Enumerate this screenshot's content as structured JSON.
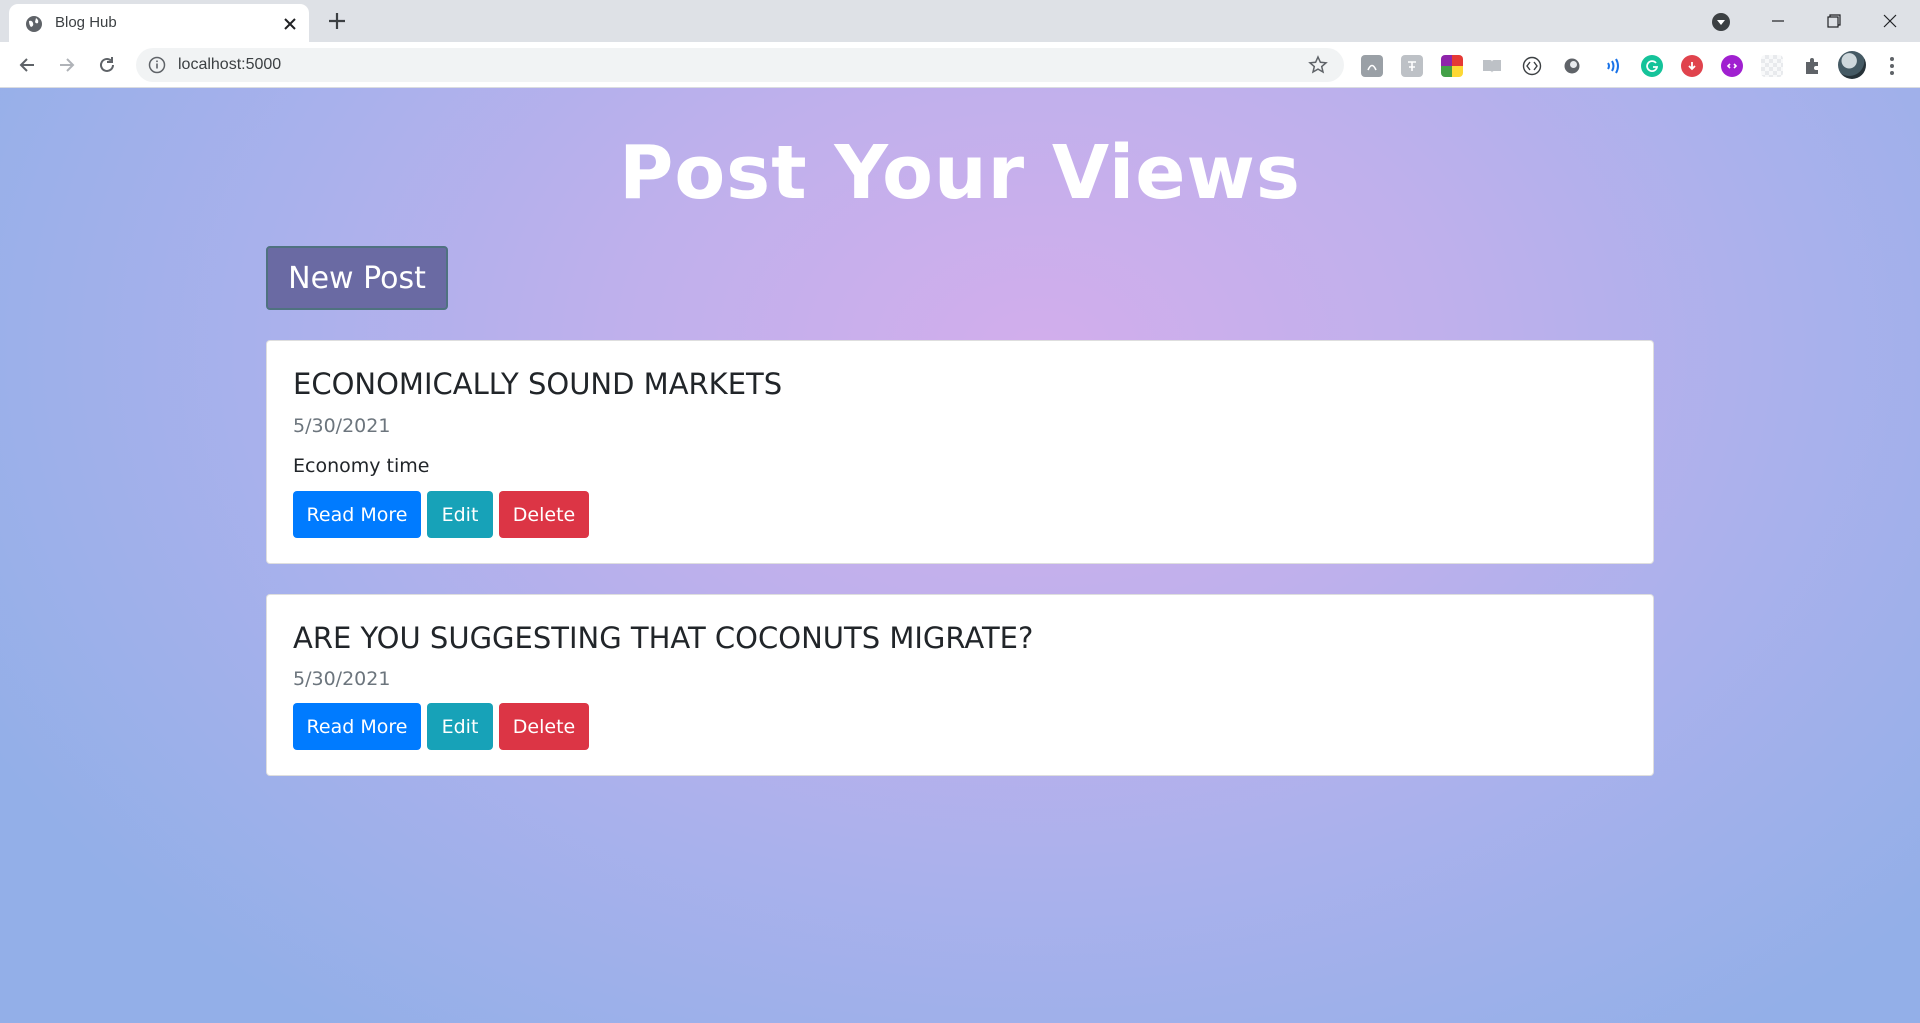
{
  "browser": {
    "tab_title": "Blog Hub",
    "url": "localhost:5000",
    "extensions": [
      "pdf-icon",
      "translate-icon",
      "color-grid-icon",
      "reader-icon",
      "code-braces-icon",
      "circle-dot-icon",
      "speech-waves-icon",
      "grammarly-icon",
      "save-icon",
      "link-circle-icon",
      "blank-extension-icon",
      "puzzle-icon"
    ]
  },
  "page": {
    "heading": "Post Your Views",
    "new_post_label": "New Post",
    "posts": [
      {
        "title": "ECONOMICALLY SOUND MARKETS",
        "date": "5/30/2021",
        "summary": "Economy time",
        "read_label": "Read More",
        "edit_label": "Edit",
        "delete_label": "Delete"
      },
      {
        "title": "ARE YOU SUGGESTING THAT COCONUTS MIGRATE?",
        "date": "5/30/2021",
        "summary": "",
        "read_label": "Read More",
        "edit_label": "Edit",
        "delete_label": "Delete"
      }
    ]
  },
  "colors": {
    "primary": "#007bff",
    "info": "#17a2b8",
    "danger": "#dc3545",
    "new_post": "#6a6aa3"
  }
}
